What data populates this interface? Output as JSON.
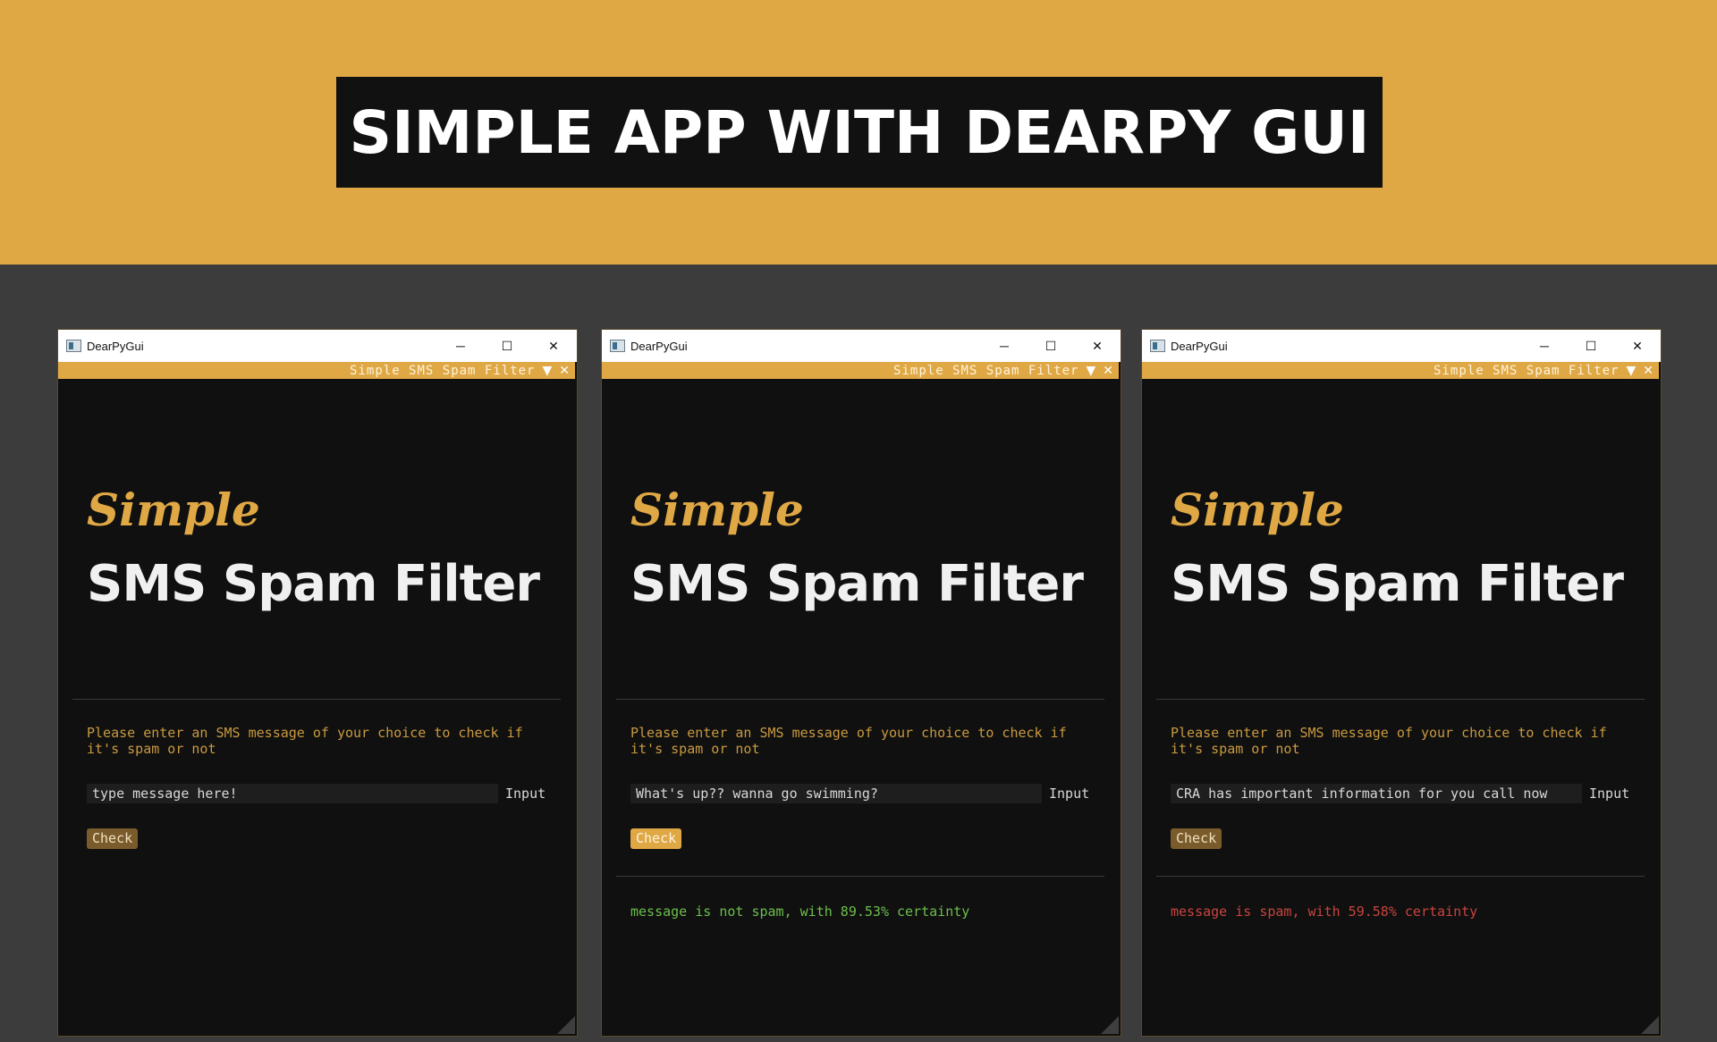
{
  "banner": {
    "title": "SIMPLE APP WITH DEARPY GUI"
  },
  "colors": {
    "accent": "#dfa845",
    "background": "#3c3c3c",
    "spam": "#c8443e",
    "not_spam": "#6cbf4c"
  },
  "windows": [
    {
      "os_title": "DearPyGui",
      "inner_title": "Simple SMS Spam Filter",
      "logo_simple": "Simple",
      "logo_main": "SMS Spam Filter",
      "prompt": "Please enter an SMS message of your choice to check if it's spam or not",
      "input_value": "type message here!",
      "input_label": "Input",
      "check_label": "Check",
      "result": ""
    },
    {
      "os_title": "DearPyGui",
      "inner_title": "Simple SMS Spam Filter",
      "logo_simple": "Simple",
      "logo_main": "SMS Spam Filter",
      "prompt": "Please enter an SMS message of your choice to check if it's spam or not",
      "input_value": "What's up?? wanna go swimming?",
      "input_label": "Input",
      "check_label": "Check",
      "result": "message is not spam, with 89.53% certainty"
    },
    {
      "os_title": "DearPyGui",
      "inner_title": "Simple SMS Spam Filter",
      "logo_simple": "Simple",
      "logo_main": "SMS Spam Filter",
      "prompt": "Please enter an SMS message of your choice to check if it's spam or not",
      "input_value": "CRA has important information for you call now",
      "input_label": "Input",
      "check_label": "Check",
      "result": "message is spam, with 59.58% certainty"
    }
  ],
  "window_controls": {
    "minimize_icon": "minimize-icon",
    "maximize_icon": "maximize-icon",
    "close_icon": "close-icon"
  }
}
